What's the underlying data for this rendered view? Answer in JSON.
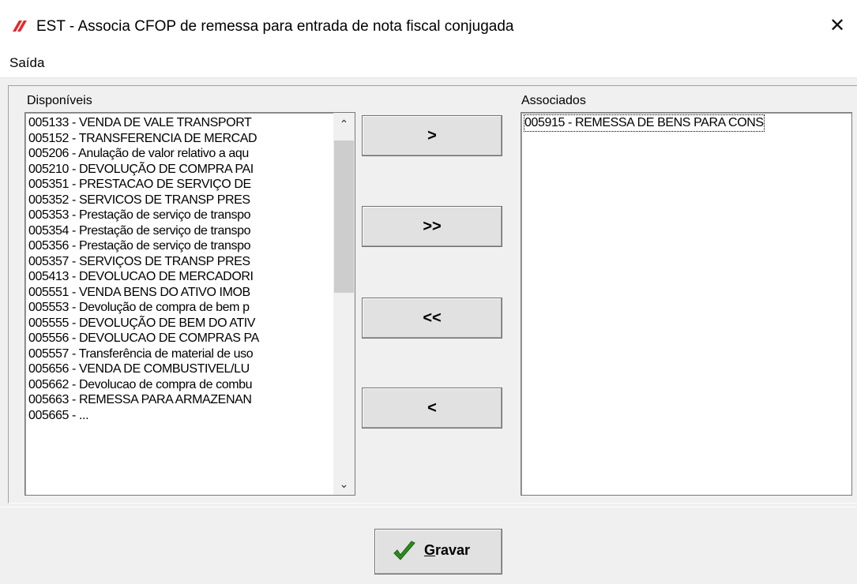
{
  "window": {
    "title": "EST - Associa CFOP de remessa para entrada de nota fiscal conjugada",
    "close_glyph": "✕",
    "app_icon": "flag-stripes-icon"
  },
  "menu": {
    "items": [
      {
        "label": "Saída"
      }
    ]
  },
  "available": {
    "label": "Disponíveis",
    "items": [
      "005133 - VENDA DE VALE TRANSPORT",
      "005152 - TRANSFERENCIA DE MERCAD",
      "005206 - Anulação de valor relativo a aqu",
      "005210 - DEVOLUÇÃO DE COMPRA PAI",
      "005351 - PRESTACAO DE SERVIÇO DE",
      "005352 - SERVICOS DE TRANSP PRES",
      "005353 - Prestação de serviço de transpo",
      "005354 - Prestação de serviço de transpo",
      "005356 - Prestação de serviço de transpo",
      "005357 - SERVIÇOS DE TRANSP PRES",
      "005413 - DEVOLUCAO DE MERCADORI",
      "005551 - VENDA BENS DO ATIVO IMOB",
      "005553 - Devolução de compra de bem p",
      "005555 - DEVOLUÇÃO DE BEM DO ATIV",
      "005556 - DEVOLUCAO DE COMPRAS PA",
      "005557 - Transferência de material de uso",
      "005656 - VENDA DE COMBUSTIVEL/LU",
      "005662 - Devolucao de compra de combu",
      "005663 - REMESSA PARA ARMAZENAN",
      "005665 - ..."
    ],
    "scroll_up_glyph": "⌃",
    "scroll_down_glyph": "⌄"
  },
  "associated": {
    "label": "Associados",
    "items": [
      "005915 - REMESSA DE BENS PARA CONS"
    ]
  },
  "buttons": {
    "add_one": ">",
    "add_all": ">>",
    "remove_all": "<<",
    "remove_one": "<"
  },
  "footer": {
    "save_label_rest": "ravar",
    "save_label_first": "G",
    "save_icon": "checkmark-icon",
    "check_color": "#2e8b1e"
  },
  "colors": {
    "icon_red": "#e8262a",
    "window_bg": "#f0f0f0"
  }
}
